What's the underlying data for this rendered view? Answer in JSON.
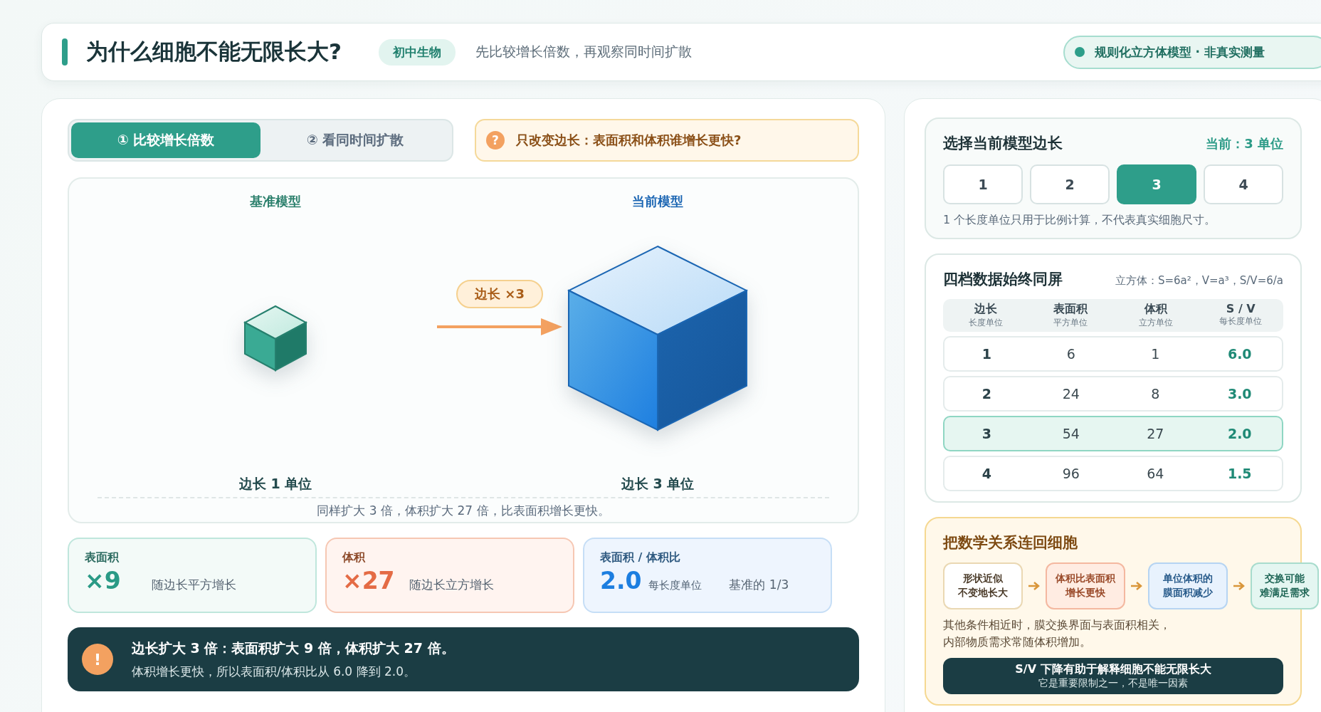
{
  "header": {
    "title": "为什么细胞不能无限长大?",
    "tag": "初中生物",
    "subtitle": "先比较增长倍数，再观察同时间扩散",
    "note": "规则化立方体模型 · 非真实测量"
  },
  "tabs": [
    {
      "label": "① 比较增长倍数",
      "selected": true
    },
    {
      "label": "② 看同时间扩散",
      "selected": false
    }
  ],
  "question": {
    "icon": "?",
    "text": "只改变边长：表面积和体积谁增长更快?"
  },
  "stage": {
    "base_label": "基准模型",
    "current_label": "当前模型",
    "arrow_label": "边长 ×3",
    "base_caption": "边长 1 单位",
    "current_caption": "边长 3 单位",
    "note": "同样扩大 3 倍，体积扩大 27 倍，比表面积增长更快。"
  },
  "stats": [
    {
      "kind": "surface",
      "label": "表面积",
      "value": "×9",
      "desc": "随边长平方增长"
    },
    {
      "kind": "volume",
      "label": "体积",
      "value": "×27",
      "desc": "随边长立方增长"
    },
    {
      "kind": "ratio",
      "label": "表面积 / 体积比",
      "value": "2.0",
      "unit": "每长度单位",
      "desc": "基准的 1/3"
    }
  ],
  "alert": {
    "icon": "!",
    "title": "边长扩大 3 倍：表面积扩大 9 倍，体积扩大 27 倍。",
    "text": "体积增长更快，所以表面积/体积比从 6.0 降到 2.0。"
  },
  "selector": {
    "title": "选择当前模型边长",
    "current": "当前：3 单位",
    "options": [
      {
        "label": "1",
        "selected": false
      },
      {
        "label": "2",
        "selected": false
      },
      {
        "label": "3",
        "selected": true
      },
      {
        "label": "4",
        "selected": false
      }
    ],
    "note": "1 个长度单位只用于比例计算，不代表真实细胞尺寸。"
  },
  "table": {
    "title": "四档数据始终同屏",
    "formula": "立方体：S=6a²，V=a³，S/V=6/a",
    "columns": [
      {
        "label": "边长",
        "unit": "长度单位"
      },
      {
        "label": "表面积",
        "unit": "平方单位"
      },
      {
        "label": "体积",
        "unit": "立方单位"
      },
      {
        "label": "S / V",
        "unit": "每长度单位"
      }
    ],
    "rows": [
      {
        "cells": [
          "1",
          "6",
          "1",
          "6.0"
        ],
        "selected": false
      },
      {
        "cells": [
          "2",
          "24",
          "8",
          "3.0"
        ],
        "selected": false
      },
      {
        "cells": [
          "3",
          "54",
          "27",
          "2.0"
        ],
        "selected": true
      },
      {
        "cells": [
          "4",
          "96",
          "64",
          "1.5"
        ],
        "selected": false
      }
    ]
  },
  "connect": {
    "title": "把数学关系连回细胞",
    "steps": [
      {
        "kind": "shape",
        "lines": [
          "形状近似",
          "不变地长大"
        ]
      },
      {
        "kind": "volume",
        "lines": [
          "体积比表面积",
          "增长更快"
        ]
      },
      {
        "kind": "membrane",
        "lines": [
          "单位体积的",
          "膜面积减少"
        ]
      },
      {
        "kind": "exchange",
        "lines": [
          "交换可能",
          "难满足需求"
        ]
      }
    ],
    "note_lines": [
      "其他条件相近时，膜交换界面与表面积相关，",
      "内部物质需求常随体积增加。"
    ],
    "conclusion": {
      "title": "S/V 下降有助于解释细胞不能无限长大",
      "text": "它是重要限制之一，不是唯一因素"
    }
  }
}
